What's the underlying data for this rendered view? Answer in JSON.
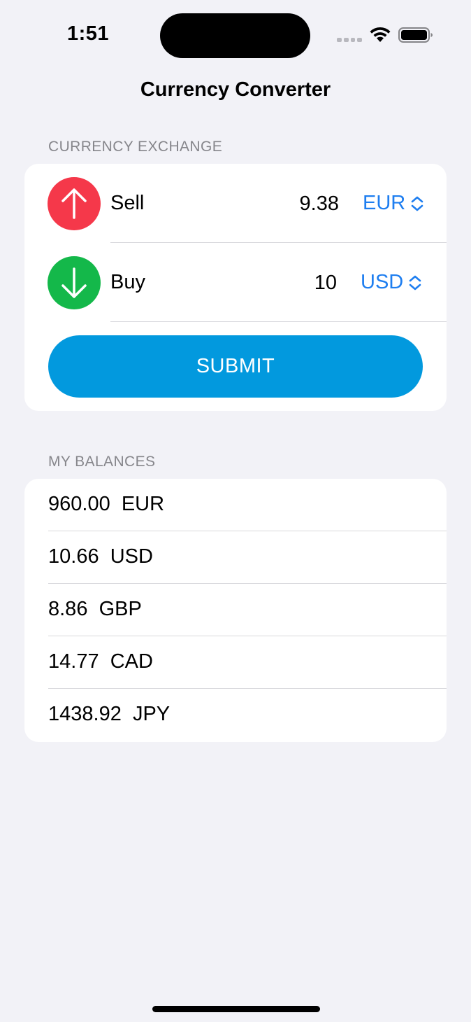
{
  "status_bar": {
    "time": "1:51"
  },
  "nav": {
    "title": "Currency Converter"
  },
  "exchange": {
    "header": "CURRENCY EXCHANGE",
    "sell": {
      "label": "Sell",
      "amount": "9.38",
      "currency": "EUR",
      "icon": "arrow-up-icon",
      "color": "#f5384a"
    },
    "buy": {
      "label": "Buy",
      "amount": "10",
      "currency": "USD",
      "icon": "arrow-down-icon",
      "color": "#14b84a"
    },
    "submit_label": "SUBMIT",
    "accent_color": "#1e7ef0",
    "button_color": "#0299de"
  },
  "balances": {
    "header": "MY BALANCES",
    "items": [
      {
        "amount": "960.00",
        "currency": "EUR"
      },
      {
        "amount": "10.66",
        "currency": "USD"
      },
      {
        "amount": "8.86",
        "currency": "GBP"
      },
      {
        "amount": "14.77",
        "currency": "CAD"
      },
      {
        "amount": "1438.92",
        "currency": "JPY"
      }
    ]
  }
}
